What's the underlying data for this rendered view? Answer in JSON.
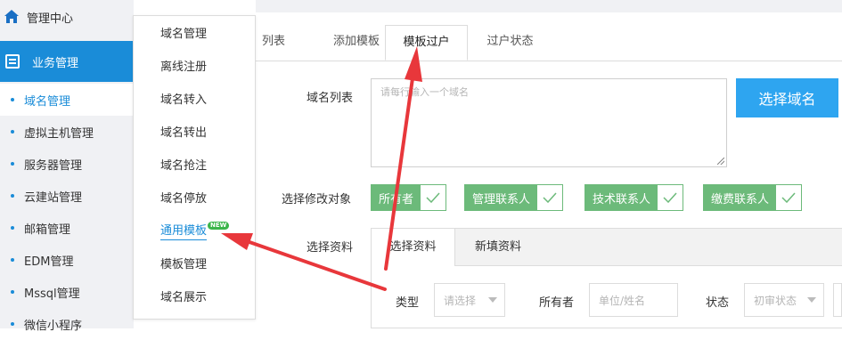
{
  "sidebar": {
    "top_label": "管理中心",
    "group_label": "业务管理",
    "items": [
      {
        "label": "域名管理"
      },
      {
        "label": "虚拟主机管理"
      },
      {
        "label": "服务器管理"
      },
      {
        "label": "云建站管理"
      },
      {
        "label": "邮箱管理"
      },
      {
        "label": "EDM管理"
      },
      {
        "label": "Mssql管理"
      },
      {
        "label": "微信小程序"
      }
    ]
  },
  "submenu": {
    "items": [
      {
        "label": "域名管理"
      },
      {
        "label": "离线注册"
      },
      {
        "label": "域名转入"
      },
      {
        "label": "域名转出"
      },
      {
        "label": "域名抢注"
      },
      {
        "label": "域名停放"
      },
      {
        "label": "通用模板"
      },
      {
        "label": "模板管理"
      },
      {
        "label": "域名展示"
      }
    ],
    "new_badge": "NEW"
  },
  "tabs": [
    {
      "label": "列表"
    },
    {
      "label": "添加模板"
    },
    {
      "label": "模板过户"
    },
    {
      "label": "过户状态"
    }
  ],
  "form": {
    "domain_list_label": "域名列表",
    "domain_list_placeholder": "请每行输入一个域名",
    "select_domain_button": "选择域名",
    "target_label": "选择修改对象",
    "targets": [
      {
        "label": "所有者"
      },
      {
        "label": "管理联系人"
      },
      {
        "label": "技术联系人"
      },
      {
        "label": "缴费联系人"
      }
    ],
    "data_label": "选择资料",
    "subtabs": [
      {
        "label": "选择资料"
      },
      {
        "label": "新填资料"
      }
    ],
    "type_label": "类型",
    "type_placeholder": "请选择",
    "owner_label": "所有者",
    "owner_placeholder": "单位/姓名",
    "status_label": "状态",
    "status_placeholder": "初审状态"
  },
  "colors": {
    "primary": "#1a8cd8",
    "button": "#2ea5f0",
    "tag_green": "#6cba7a",
    "arrow_red": "#e8373b"
  }
}
